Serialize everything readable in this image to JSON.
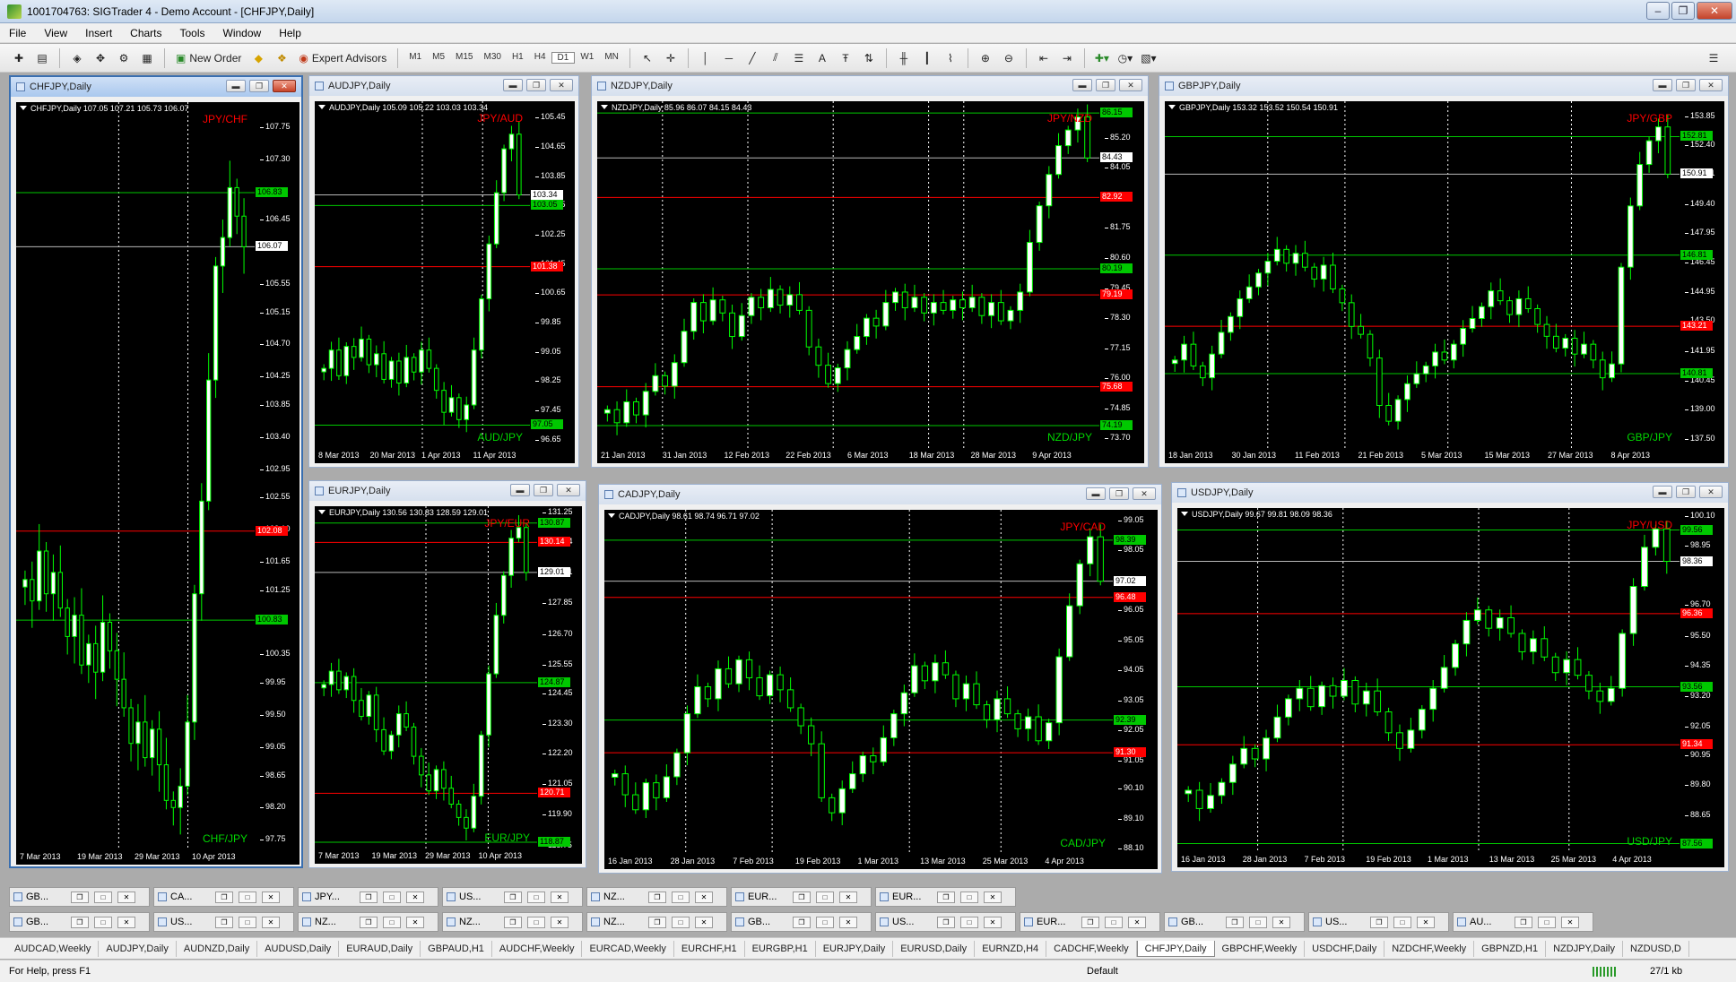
{
  "app": {
    "title": "1001704763: SIGTrader 4 - Demo Account - [CHFJPY,Daily]"
  },
  "menu": [
    "File",
    "View",
    "Insert",
    "Charts",
    "Tools",
    "Window",
    "Help"
  ],
  "toolbar": {
    "new_order": "New Order",
    "expert_advisors": "Expert Advisors",
    "timeframes": [
      "M1",
      "M5",
      "M15",
      "M30",
      "H1",
      "H4",
      "D1",
      "W1",
      "MN"
    ]
  },
  "charts": [
    {
      "id": "chfjpy",
      "title": "CHFJPY,Daily",
      "info": "CHFJPY,Daily  107.05 107.21 105.73 106.07",
      "pair_label": "JPY/CHF",
      "pair_label_bottom": "CHF/JPY",
      "ylim": [
        97.6,
        108.1
      ],
      "yticks": [
        "107.75",
        "107.30",
        "106.45",
        "105.55",
        "105.15",
        "104.70",
        "104.25",
        "103.85",
        "103.40",
        "102.95",
        "102.55",
        "102.10",
        "101.65",
        "101.25",
        "100.35",
        "99.95",
        "99.50",
        "99.05",
        "98.65",
        "98.20",
        "97.75"
      ],
      "yvals": [
        107.75,
        107.3,
        106.45,
        105.55,
        105.15,
        104.7,
        104.25,
        103.85,
        103.4,
        102.95,
        102.55,
        102.1,
        101.65,
        101.25,
        100.35,
        99.95,
        99.5,
        99.05,
        98.65,
        98.2,
        97.75
      ],
      "levels": [
        {
          "value": 106.83,
          "label": "106.83",
          "color": "#00C800"
        },
        {
          "value": 102.08,
          "label": "102.08",
          "color": "#FF0000"
        },
        {
          "value": 100.83,
          "label": "100.83",
          "color": "#00C800"
        }
      ],
      "price": {
        "value": 106.07,
        "label": "106.07"
      },
      "xticks": [
        "7 Mar 2013",
        "19 Mar 2013",
        "29 Mar 2013",
        "10 Apr 2013"
      ],
      "vlines": [
        0.43,
        0.72
      ],
      "closes": [
        101.4,
        101.1,
        101.8,
        101.2,
        101.5,
        101.0,
        100.6,
        100.9,
        100.2,
        100.5,
        100.1,
        100.8,
        100.4,
        100.0,
        99.6,
        99.1,
        99.4,
        98.9,
        99.3,
        98.8,
        98.3,
        98.2,
        98.5,
        99.4,
        101.2,
        102.5,
        104.2,
        105.8,
        106.2,
        106.9,
        106.5,
        106.07
      ]
    },
    {
      "id": "audjpy",
      "title": "AUDJPY,Daily",
      "info": "AUDJPY,Daily  105.09 105.22 103.03 103.34",
      "pair_label": "JPY/AUD",
      "pair_label_bottom": "AUD/JPY",
      "ylim": [
        96.4,
        105.9
      ],
      "yticks": [
        "105.45",
        "104.65",
        "103.85",
        "103.05",
        "102.25",
        "101.45",
        "100.65",
        "99.85",
        "99.05",
        "98.25",
        "97.45",
        "96.65"
      ],
      "yvals": [
        105.45,
        104.65,
        103.85,
        103.05,
        102.25,
        101.45,
        100.65,
        99.85,
        99.05,
        98.25,
        97.45,
        96.65
      ],
      "levels": [
        {
          "value": 103.05,
          "label": "103.05",
          "color": "#00C800"
        },
        {
          "value": 101.38,
          "label": "101.38",
          "color": "#FF0000"
        },
        {
          "value": 97.05,
          "label": "97.05",
          "color": "#00C800"
        }
      ],
      "price": {
        "value": 103.34,
        "label": "103.34"
      },
      "xticks": [
        "8 Mar 2013",
        "20 Mar 2013",
        "1 Apr 2013",
        "11 Apr 2013"
      ],
      "vlines": [
        0.5,
        0.78
      ],
      "closes": [
        98.6,
        99.1,
        98.4,
        99.2,
        98.9,
        99.4,
        98.7,
        99.0,
        98.3,
        98.8,
        98.2,
        98.9,
        98.5,
        99.1,
        98.6,
        98.0,
        97.4,
        97.8,
        97.2,
        97.6,
        99.1,
        100.5,
        102.0,
        103.4,
        104.6,
        105.0,
        103.34
      ]
    },
    {
      "id": "nzdjpy",
      "title": "NZDJPY,Daily",
      "info": "NZDJPY,Daily  85.96 86.07 84.15 84.43",
      "pair_label": "JPY/NZD",
      "pair_label_bottom": "NZD/JPY",
      "ylim": [
        73.3,
        86.6
      ],
      "yticks": [
        "86.15",
        "85.20",
        "84.05",
        "82.95",
        "81.75",
        "80.60",
        "79.45",
        "78.30",
        "77.15",
        "76.00",
        "74.85",
        "73.70"
      ],
      "yvals": [
        86.15,
        85.2,
        84.05,
        82.95,
        81.75,
        80.6,
        79.45,
        78.3,
        77.15,
        76.0,
        74.85,
        73.7
      ],
      "levels": [
        {
          "value": 86.15,
          "label": "86.15",
          "color": "#00C800"
        },
        {
          "value": 82.92,
          "label": "82.92",
          "color": "#FF0000"
        },
        {
          "value": 80.19,
          "label": "80.19",
          "color": "#00C800"
        },
        {
          "value": 79.19,
          "label": "79.19",
          "color": "#FF0000"
        },
        {
          "value": 75.68,
          "label": "75.68",
          "color": "#FF0000"
        },
        {
          "value": 74.19,
          "label": "74.19",
          "color": "#00C800"
        }
      ],
      "price": {
        "value": 84.43,
        "label": "84.43"
      },
      "xticks": [
        "21 Jan 2013",
        "31 Jan 2013",
        "12 Feb 2013",
        "22 Feb 2013",
        "6 Mar 2013",
        "18 Mar 2013",
        "28 Mar 2013",
        "9 Apr 2013"
      ],
      "vlines": [
        0.13,
        0.3,
        0.47,
        0.66,
        0.73
      ],
      "closes": [
        74.8,
        74.3,
        75.1,
        74.6,
        75.5,
        76.1,
        75.7,
        76.6,
        77.8,
        78.9,
        78.2,
        79.0,
        78.5,
        77.6,
        78.4,
        79.1,
        78.7,
        79.4,
        78.8,
        79.2,
        78.6,
        77.2,
        76.5,
        75.8,
        76.4,
        77.1,
        77.6,
        78.3,
        78.0,
        78.9,
        79.3,
        78.7,
        79.1,
        78.5,
        78.9,
        78.6,
        79.0,
        78.7,
        79.1,
        78.4,
        78.9,
        78.2,
        78.6,
        79.3,
        81.2,
        82.6,
        83.8,
        84.9,
        85.5,
        86.0,
        84.43
      ]
    },
    {
      "id": "gbpjpy",
      "title": "GBPJPY,Daily",
      "info": "GBPJPY,Daily  153.32 153.52 150.54 150.91",
      "pair_label": "JPY/GBP",
      "pair_label_bottom": "GBP/JPY",
      "ylim": [
        137.0,
        154.6
      ],
      "yticks": [
        "153.85",
        "152.40",
        "150.91",
        "149.40",
        "147.95",
        "146.45",
        "144.95",
        "143.50",
        "141.95",
        "140.45",
        "139.00",
        "137.50"
      ],
      "yvals": [
        153.85,
        152.4,
        150.91,
        149.4,
        147.95,
        146.45,
        144.95,
        143.5,
        141.95,
        140.45,
        139.0,
        137.5
      ],
      "levels": [
        {
          "value": 152.81,
          "label": "152.81",
          "color": "#00C800"
        },
        {
          "value": 146.81,
          "label": "146.81",
          "color": "#00C800"
        },
        {
          "value": 143.21,
          "label": "143.21",
          "color": "#FF0000"
        },
        {
          "value": 140.81,
          "label": "140.81",
          "color": "#00C800"
        }
      ],
      "price": {
        "value": 150.91,
        "label": "150.91"
      },
      "xticks": [
        "18 Jan 2013",
        "30 Jan 2013",
        "11 Feb 2013",
        "21 Feb 2013",
        "5 Mar 2013",
        "15 Mar 2013",
        "27 Mar 2013",
        "8 Apr 2013"
      ],
      "vlines": [
        0.2,
        0.35,
        0.55,
        0.79
      ],
      "closes": [
        141.5,
        142.3,
        141.2,
        140.6,
        141.8,
        142.9,
        143.7,
        144.6,
        145.2,
        145.9,
        146.5,
        147.1,
        146.4,
        146.9,
        146.2,
        145.6,
        146.3,
        145.1,
        144.4,
        143.2,
        142.8,
        141.6,
        139.2,
        138.4,
        139.5,
        140.3,
        140.8,
        141.2,
        141.9,
        141.5,
        142.3,
        143.1,
        143.6,
        144.2,
        145.0,
        144.5,
        143.8,
        144.6,
        144.1,
        143.3,
        142.7,
        142.1,
        142.6,
        141.8,
        142.3,
        141.5,
        140.6,
        141.3,
        146.2,
        149.3,
        151.4,
        152.6,
        153.3,
        150.91
      ]
    },
    {
      "id": "eurjpy",
      "title": "EURJPY,Daily",
      "info": "EURJPY,Daily  130.56 130.83 128.59 129.01",
      "pair_label": "JPY/EUR",
      "pair_label_bottom": "EUR/JPY",
      "ylim": [
        118.6,
        131.5
      ],
      "yticks": [
        "131.25",
        "130.14",
        "129.01",
        "127.85",
        "126.70",
        "125.55",
        "124.45",
        "123.30",
        "122.20",
        "121.05",
        "119.90",
        "118.75"
      ],
      "yvals": [
        131.25,
        130.14,
        129.01,
        127.85,
        126.7,
        125.55,
        124.45,
        123.3,
        122.2,
        121.05,
        119.9,
        118.75
      ],
      "levels": [
        {
          "value": 130.87,
          "label": "130.87",
          "color": "#00C800"
        },
        {
          "value": 130.14,
          "label": "130.14",
          "color": "#FF0000"
        },
        {
          "value": 124.87,
          "label": "124.87",
          "color": "#00C800"
        },
        {
          "value": 120.71,
          "label": "120.71",
          "color": "#FF0000"
        },
        {
          "value": 118.87,
          "label": "118.87",
          "color": "#00C800"
        }
      ],
      "price": {
        "value": 129.01,
        "label": "129.01"
      },
      "xticks": [
        "7 Mar 2013",
        "19 Mar 2013",
        "29 Mar 2013",
        "10 Apr 2013"
      ],
      "vlines": [
        0.5,
        0.78
      ],
      "closes": [
        124.8,
        125.3,
        124.6,
        125.1,
        124.2,
        123.6,
        124.4,
        123.1,
        122.3,
        122.9,
        123.7,
        123.2,
        122.1,
        121.4,
        120.8,
        121.6,
        120.9,
        120.3,
        119.8,
        119.4,
        120.6,
        122.9,
        125.2,
        127.4,
        128.9,
        130.3,
        130.7,
        129.01
      ]
    },
    {
      "id": "cadjpy",
      "title": "CADJPY,Daily",
      "info": "CADJPY,Daily  98.61 98.74 96.71 97.02",
      "pair_label": "JPY/CAD",
      "pair_label_bottom": "CAD/JPY",
      "ylim": [
        87.9,
        99.4
      ],
      "yticks": [
        "99.05",
        "98.05",
        "97.02",
        "96.05",
        "95.05",
        "94.05",
        "93.05",
        "92.05",
        "91.05",
        "90.10",
        "89.10",
        "88.10"
      ],
      "yvals": [
        99.05,
        98.05,
        97.02,
        96.05,
        95.05,
        94.05,
        93.05,
        92.05,
        91.05,
        90.1,
        89.1,
        88.1
      ],
      "levels": [
        {
          "value": 98.39,
          "label": "98.39",
          "color": "#00C800"
        },
        {
          "value": 96.48,
          "label": "96.48",
          "color": "#FF0000"
        },
        {
          "value": 92.39,
          "label": "92.39",
          "color": "#00C800"
        },
        {
          "value": 91.3,
          "label": "91.30",
          "color": "#FF0000"
        }
      ],
      "price": {
        "value": 97.02,
        "label": "97.02"
      },
      "xticks": [
        "16 Jan 2013",
        "28 Jan 2013",
        "7 Feb 2013",
        "19 Feb 2013",
        "1 Mar 2013",
        "13 Mar 2013",
        "25 Mar 2013",
        "4 Apr 2013"
      ],
      "vlines": [
        0.16,
        0.33,
        0.6,
        0.78
      ],
      "closes": [
        90.6,
        89.9,
        89.4,
        90.3,
        89.8,
        90.5,
        91.3,
        92.6,
        93.5,
        93.1,
        94.1,
        93.6,
        94.4,
        93.8,
        93.2,
        93.9,
        93.4,
        92.8,
        92.2,
        91.6,
        89.8,
        89.3,
        90.1,
        90.6,
        91.2,
        91.0,
        91.8,
        92.6,
        93.3,
        94.2,
        93.7,
        94.3,
        93.9,
        93.1,
        93.6,
        92.9,
        92.4,
        93.1,
        92.6,
        92.1,
        92.5,
        91.7,
        92.3,
        94.5,
        96.2,
        97.6,
        98.5,
        97.02
      ]
    },
    {
      "id": "usdjpy",
      "title": "USDJPY,Daily",
      "info": "USDJPY,Daily  99.67 99.81 98.09 98.36",
      "pair_label": "JPY/USD",
      "pair_label_bottom": "USD/JPY",
      "ylim": [
        87.2,
        100.4
      ],
      "yticks": [
        "100.10",
        "98.95",
        "98.36",
        "96.70",
        "95.50",
        "94.35",
        "93.20",
        "92.05",
        "90.95",
        "89.80",
        "88.65"
      ],
      "yvals": [
        100.1,
        98.95,
        98.36,
        96.7,
        95.5,
        94.35,
        93.2,
        92.05,
        90.95,
        89.8,
        88.65
      ],
      "levels": [
        {
          "value": 99.56,
          "label": "99.56",
          "color": "#00C800"
        },
        {
          "value": 96.36,
          "label": "96.36",
          "color": "#FF0000"
        },
        {
          "value": 93.56,
          "label": "93.56",
          "color": "#00C800"
        },
        {
          "value": 91.34,
          "label": "91.34",
          "color": "#FF0000"
        },
        {
          "value": 87.56,
          "label": "87.56",
          "color": "#00C800"
        }
      ],
      "price": {
        "value": 98.36,
        "label": "98.36"
      },
      "xticks": [
        "16 Jan 2013",
        "28 Jan 2013",
        "7 Feb 2013",
        "19 Feb 2013",
        "1 Mar 2013",
        "13 Mar 2013",
        "25 Mar 2013",
        "4 Apr 2013"
      ],
      "vlines": [
        0.16,
        0.33,
        0.6,
        0.78
      ],
      "closes": [
        89.6,
        88.9,
        89.4,
        89.9,
        90.6,
        91.2,
        90.8,
        91.6,
        92.4,
        93.1,
        93.5,
        92.8,
        93.6,
        93.2,
        93.8,
        92.9,
        93.4,
        92.6,
        91.8,
        91.2,
        91.9,
        92.7,
        93.5,
        94.3,
        95.2,
        96.1,
        96.5,
        95.8,
        96.2,
        95.6,
        94.9,
        95.4,
        94.7,
        94.1,
        94.6,
        94.0,
        93.4,
        93.0,
        93.5,
        95.6,
        97.4,
        98.9,
        99.6,
        98.36
      ]
    }
  ],
  "minimized_rows": [
    [
      "GB...",
      "CA...",
      "JPY...",
      "US...",
      "NZ...",
      "EUR...",
      "EUR..."
    ],
    [
      "GB...",
      "US...",
      "NZ...",
      "NZ...",
      "NZ...",
      "GB...",
      "US...",
      "EUR...",
      "GB...",
      "US...",
      "AU..."
    ]
  ],
  "tabs": [
    "AUDCAD,Weekly",
    "AUDJPY,Daily",
    "AUDNZD,Daily",
    "AUDUSD,Daily",
    "EURAUD,Daily",
    "GBPAUD,H1",
    "AUDCHF,Weekly",
    "EURCAD,Weekly",
    "EURCHF,H1",
    "EURGBP,H1",
    "EURJPY,Daily",
    "EURUSD,Daily",
    "EURNZD,H4",
    "CADCHF,Weekly",
    "CHFJPY,Daily",
    "GBPCHF,Weekly",
    "USDCHF,Daily",
    "NZDCHF,Weekly",
    "GBPNZD,H1",
    "NZDJPY,Daily",
    "NZDUSD,D"
  ],
  "active_tab": "CHFJPY,Daily",
  "status": {
    "help": "For Help, press F1",
    "profile": "Default",
    "traffic": "27/1 kb"
  },
  "colors": {
    "bull": "#FFFFFF",
    "bear": "#000000",
    "wick": "#00FF00",
    "grid": "#FFFFFF",
    "support": "#00C800",
    "resistance": "#FF0000"
  }
}
